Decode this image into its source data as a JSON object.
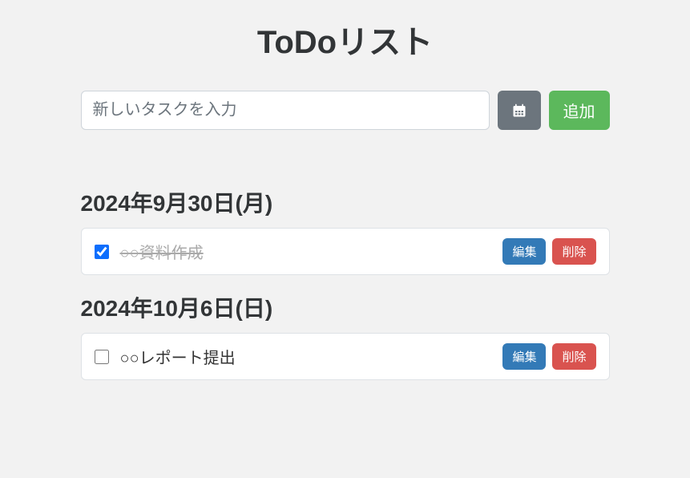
{
  "title": "ToDoリスト",
  "input": {
    "placeholder": "新しいタスクを入力",
    "add_label": "追加"
  },
  "buttons": {
    "edit": "編集",
    "delete": "削除"
  },
  "groups": [
    {
      "date": "2024年9月30日(月)",
      "tasks": [
        {
          "text": "○○資料作成",
          "completed": true
        }
      ]
    },
    {
      "date": "2024年10月6日(日)",
      "tasks": [
        {
          "text": "○○レポート提出",
          "completed": false
        }
      ]
    }
  ]
}
